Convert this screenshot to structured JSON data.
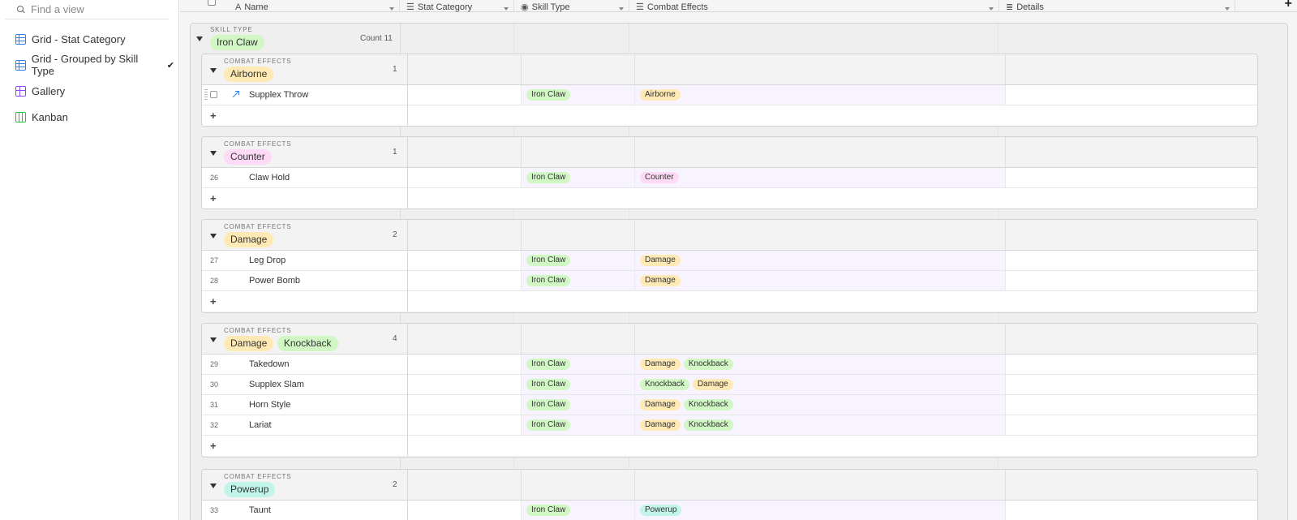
{
  "sidebar": {
    "search_placeholder": "Find a view",
    "views": [
      {
        "label": "Grid - Stat Category",
        "icon": "grid-view-icon",
        "active": false
      },
      {
        "label": "Grid - Grouped by Skill Type",
        "icon": "grid-view-icon",
        "active": true
      },
      {
        "label": "Gallery",
        "icon": "gallery-view-icon",
        "active": false
      },
      {
        "label": "Kanban",
        "icon": "kanban-view-icon",
        "active": false
      }
    ],
    "active_check": "✔"
  },
  "columns": {
    "name": "Name",
    "stat_category": "Stat Category",
    "skill_type": "Skill Type",
    "combat_effects": "Combat Effects",
    "details": "Details"
  },
  "add_column": "+",
  "outer_group": {
    "label": "SKILL TYPE",
    "value": "Iron Claw",
    "count_text": "Count 11"
  },
  "sub_group_label": "COMBAT EFFECTS",
  "add_row": "+",
  "groups": [
    {
      "tags": [
        "Airborne"
      ],
      "count": "1",
      "rows": [
        {
          "num": "",
          "name": "Supplex Throw",
          "skill_type": "Iron Claw",
          "effects": [
            "Airborne"
          ]
        }
      ]
    },
    {
      "tags": [
        "Counter"
      ],
      "count": "1",
      "rows": [
        {
          "num": "26",
          "name": "Claw Hold",
          "skill_type": "Iron Claw",
          "effects": [
            "Counter"
          ]
        }
      ]
    },
    {
      "tags": [
        "Damage"
      ],
      "count": "2",
      "rows": [
        {
          "num": "27",
          "name": "Leg Drop",
          "skill_type": "Iron Claw",
          "effects": [
            "Damage"
          ]
        },
        {
          "num": "28",
          "name": "Power Bomb",
          "skill_type": "Iron Claw",
          "effects": [
            "Damage"
          ]
        }
      ]
    },
    {
      "tags": [
        "Damage",
        "Knockback"
      ],
      "count": "4",
      "rows": [
        {
          "num": "29",
          "name": "Takedown",
          "skill_type": "Iron Claw",
          "effects": [
            "Damage",
            "Knockback"
          ]
        },
        {
          "num": "30",
          "name": "Supplex Slam",
          "skill_type": "Iron Claw",
          "effects": [
            "Knockback",
            "Damage"
          ]
        },
        {
          "num": "31",
          "name": "Horn Style",
          "skill_type": "Iron Claw",
          "effects": [
            "Damage",
            "Knockback"
          ]
        },
        {
          "num": "32",
          "name": "Lariat",
          "skill_type": "Iron Claw",
          "effects": [
            "Damage",
            "Knockback"
          ]
        }
      ]
    },
    {
      "tags": [
        "Powerup"
      ],
      "count": "2",
      "rows": [
        {
          "num": "33",
          "name": "Taunt",
          "skill_type": "Iron Claw",
          "effects": [
            "Powerup"
          ]
        }
      ]
    }
  ],
  "tag_colors": {
    "Iron Claw": "#d1f7c4",
    "Airborne": "#ffeab6",
    "Counter": "#ffdaf6",
    "Damage": "#ffeab6",
    "Knockback": "#d1f7c4",
    "Powerup": "#c2f5e9"
  }
}
